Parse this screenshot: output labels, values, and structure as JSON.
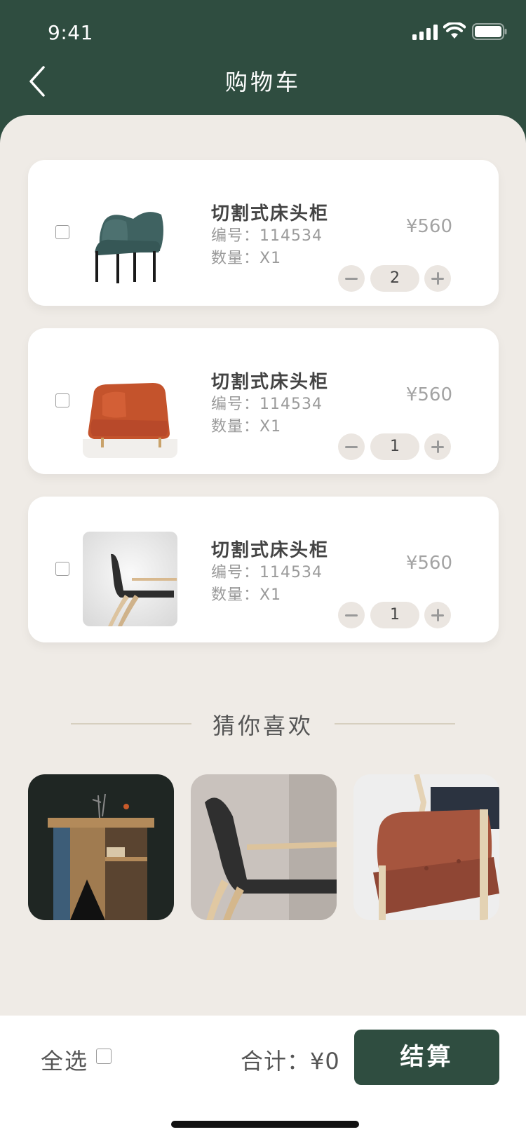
{
  "status_bar": {
    "time": "9:41"
  },
  "header": {
    "title": "购物车"
  },
  "cart": {
    "items": [
      {
        "name": "切割式床头柜",
        "code": "编号：114534",
        "qty_label": "数量：X1",
        "price": "¥560",
        "quantity": "2",
        "image": "teal-armchair"
      },
      {
        "name": "切割式床头柜",
        "code": "编号：114534",
        "qty_label": "数量：X1",
        "price": "¥560",
        "quantity": "1",
        "image": "orange-armchair"
      },
      {
        "name": "切割式床头柜",
        "code": "编号：114534",
        "qty_label": "数量：X1",
        "price": "¥560",
        "quantity": "1",
        "image": "bentwood-chair"
      }
    ]
  },
  "recommend": {
    "title": "猜你喜欢",
    "items": [
      {
        "image": "wooden-side-table"
      },
      {
        "image": "bentwood-chair-closeup"
      },
      {
        "image": "rust-fabric-armchair"
      }
    ]
  },
  "footer": {
    "select_all": "全选",
    "total": "合计：¥0",
    "checkout": "结算"
  },
  "colors": {
    "brand_green": "#2f4d40",
    "panel_bg": "#efebe6",
    "stepper_bg": "#ebe6e1"
  }
}
